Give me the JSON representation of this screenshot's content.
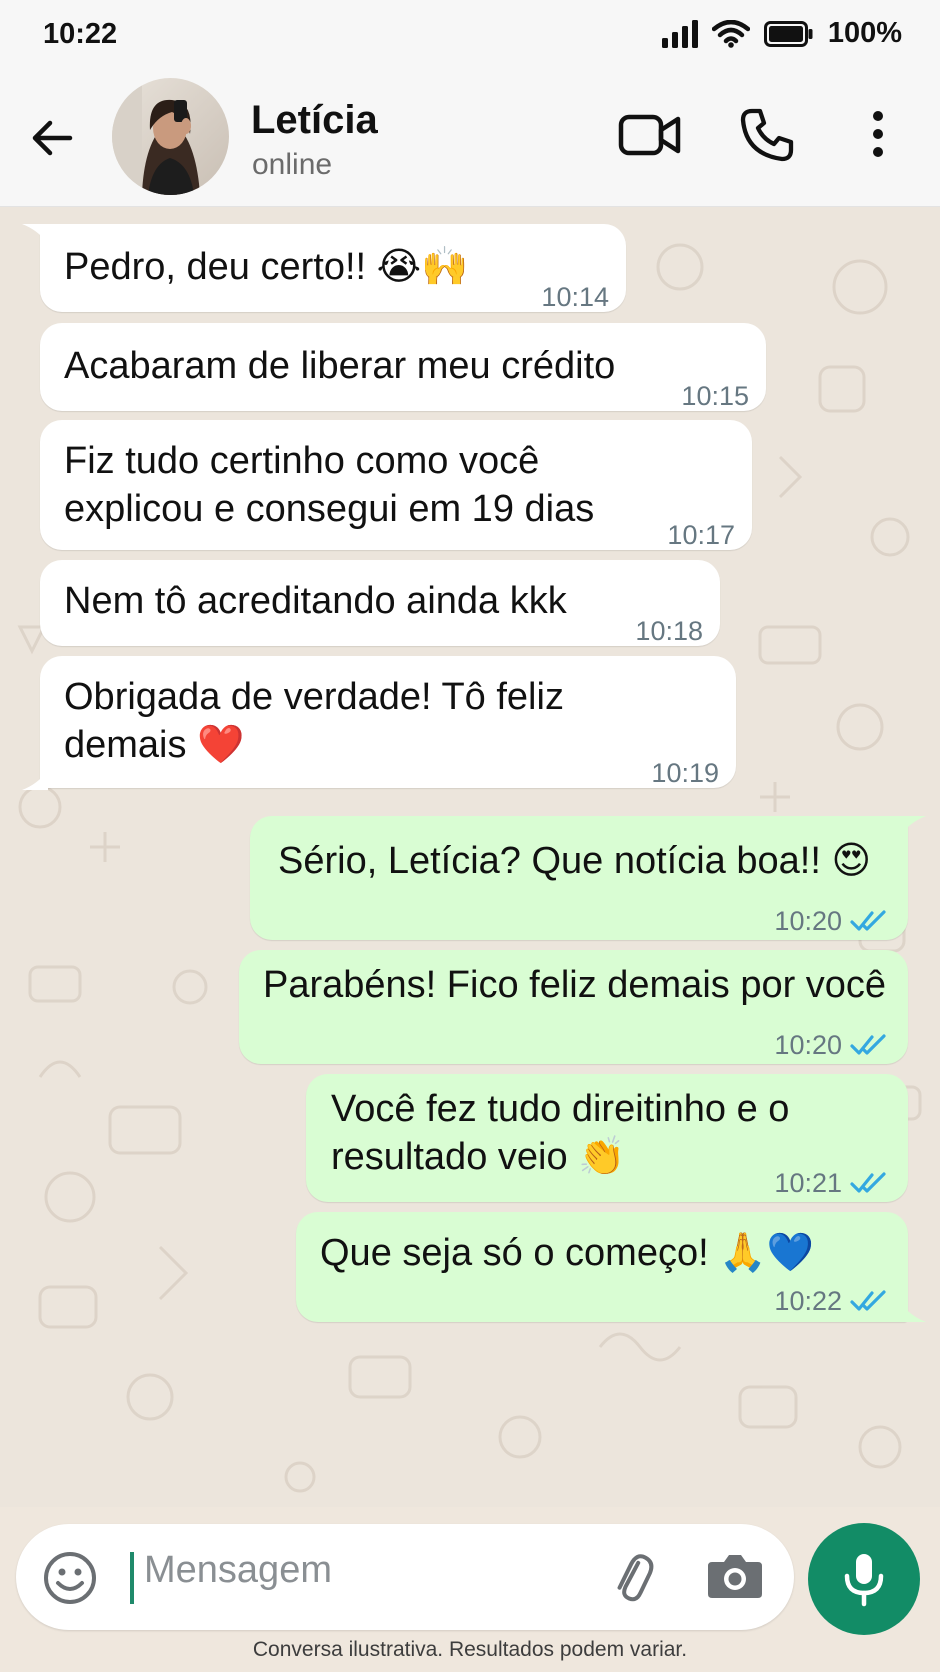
{
  "status": {
    "time": "10:22",
    "battery": "100%"
  },
  "contact": {
    "name": "Letícia",
    "status": "online"
  },
  "messages": [
    {
      "dir": "in",
      "text": [
        "Pedro, deu certo!! 😭🙌"
      ],
      "time": "10:14"
    },
    {
      "dir": "in",
      "text": [
        "Acabaram de liberar meu crédito"
      ],
      "time": "10:15"
    },
    {
      "dir": "in",
      "text": [
        "Fiz tudo certinho como você",
        "explicou e consegui em 19 dias"
      ],
      "time": "10:17"
    },
    {
      "dir": "in",
      "text": [
        "Nem tô acreditando ainda kkk"
      ],
      "time": "10:18"
    },
    {
      "dir": "in",
      "text": [
        "Obrigada de verdade! Tô feliz",
        "demais ❤️"
      ],
      "time": "10:19"
    },
    {
      "dir": "out",
      "text": [
        "Sério, Letícia? Que notícia boa!! 😍"
      ],
      "time": "10:20",
      "read": true
    },
    {
      "dir": "out",
      "text": [
        "Parabéns! Fico feliz demais por você"
      ],
      "time": "10:20",
      "read": true
    },
    {
      "dir": "out",
      "text": [
        "Você fez tudo direitinho e o",
        "resultado veio 👏"
      ],
      "time": "10:21",
      "read": true
    },
    {
      "dir": "out",
      "text": [
        "Que seja só o começo! 🙏💙"
      ],
      "time": "10:22",
      "read": true
    }
  ],
  "composer": {
    "placeholder": "Mensagem"
  },
  "footer": {
    "disclaimer": "Conversa ilustrativa. Resultados podem variar."
  },
  "colors": {
    "incoming": "#ffffff",
    "outgoing": "#d9fdd3",
    "accent": "#128c66",
    "read_ticks": "#34a8e0"
  },
  "icons": [
    "back-arrow-icon",
    "video-call-icon",
    "phone-icon",
    "more-vert-icon",
    "emoji-icon",
    "attach-icon",
    "camera-icon",
    "mic-icon",
    "double-check-icon"
  ]
}
